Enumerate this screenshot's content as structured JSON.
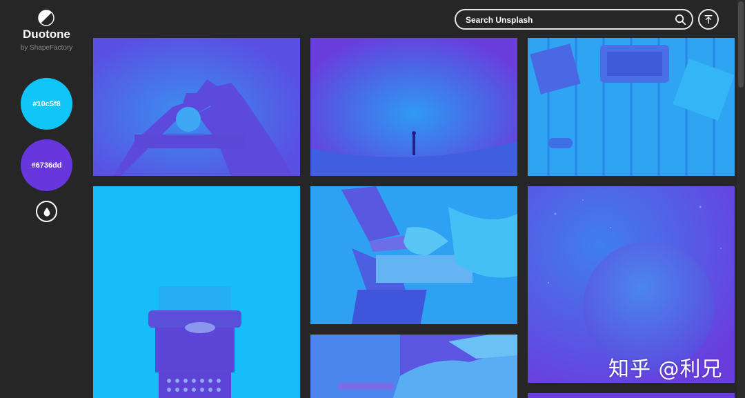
{
  "app": {
    "title": "Duotone",
    "subtitle": "by ShapeFactory"
  },
  "palette": {
    "color_1": {
      "label": "#10c5f8",
      "hex": "#10c5f8"
    },
    "color_2": {
      "label": "#6736dd",
      "hex": "#6736dd"
    },
    "drop_icon": "water-drop-icon"
  },
  "header": {
    "search_placeholder": "Search Unsplash",
    "search_icon": "search-icon",
    "top_icon": "arrow-up-to-top-icon"
  },
  "gallery": {
    "photos": [
      {
        "subject": "hands-heart"
      },
      {
        "subject": "night-sky-person"
      },
      {
        "subject": "desk-typewriter-topview"
      },
      {
        "subject": "typewriter"
      },
      {
        "subject": "laptops-meeting"
      },
      {
        "subject": "planet-space"
      },
      {
        "subject": "people-laptop"
      },
      {
        "subject": "partial-bottom"
      }
    ]
  },
  "watermark": "知乎 @利兄"
}
